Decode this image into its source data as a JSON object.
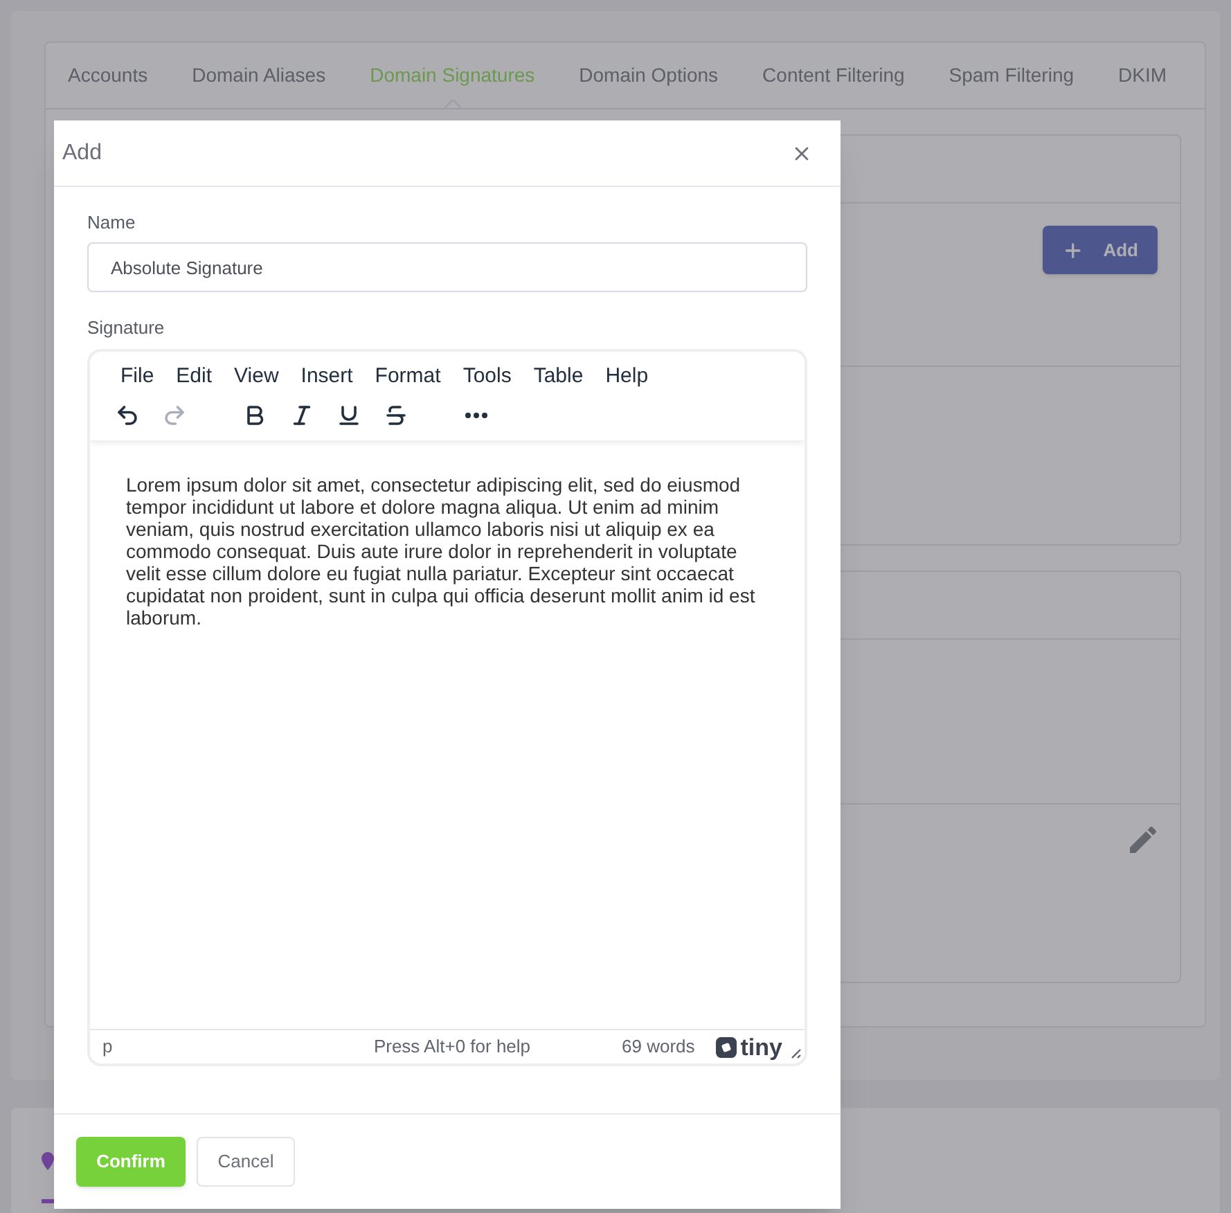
{
  "tabs": [
    {
      "label": "Accounts",
      "selected": false
    },
    {
      "label": "Domain Aliases",
      "selected": false
    },
    {
      "label": "Domain Signatures",
      "selected": true
    },
    {
      "label": "Domain Options",
      "selected": false
    },
    {
      "label": "Content Filtering",
      "selected": false
    },
    {
      "label": "Spam Filtering",
      "selected": false
    },
    {
      "label": "DKIM",
      "selected": false
    }
  ],
  "background": {
    "add_button": "Add"
  },
  "dialog": {
    "title": "Add",
    "name_field": {
      "label": "Name",
      "value": "Absolute Signature"
    },
    "editor": {
      "label": "Signature",
      "menu": [
        "File",
        "Edit",
        "View",
        "Insert",
        "Format",
        "Tools",
        "Table",
        "Help"
      ],
      "toolbar_groups": [
        {
          "items": [
            {
              "kind": "undo",
              "disabled": false
            },
            {
              "kind": "redo",
              "disabled": true
            }
          ]
        },
        {
          "items": [
            {
              "kind": "bold",
              "disabled": false
            },
            {
              "kind": "italic",
              "disabled": false
            },
            {
              "kind": "underline",
              "disabled": false
            },
            {
              "kind": "strikethrough",
              "disabled": false
            }
          ]
        },
        {
          "items": [
            {
              "kind": "more",
              "disabled": false
            }
          ]
        }
      ],
      "content": "Lorem ipsum dolor sit amet, consectetur adipiscing elit, sed do eiusmod tempor incididunt ut labore et dolore magna aliqua. Ut enim ad minim veniam, quis nostrud exercitation ullamco laboris nisi ut aliquip ex ea commodo consequat. Duis aute irure dolor in reprehenderit in voluptate velit esse cillum dolore eu fugiat nulla pariatur. Excepteur sint occaecat cupidatat non proident, sunt in culpa qui officia deserunt mollit anim id est laborum.",
      "status": {
        "path": "p",
        "help": "Press Alt+0 for help",
        "word_count": "69 words",
        "brand": "tiny"
      }
    },
    "buttons": [
      {
        "kind": "primary",
        "label": "Confirm"
      },
      {
        "kind": "secondary",
        "label": "Cancel"
      }
    ]
  }
}
